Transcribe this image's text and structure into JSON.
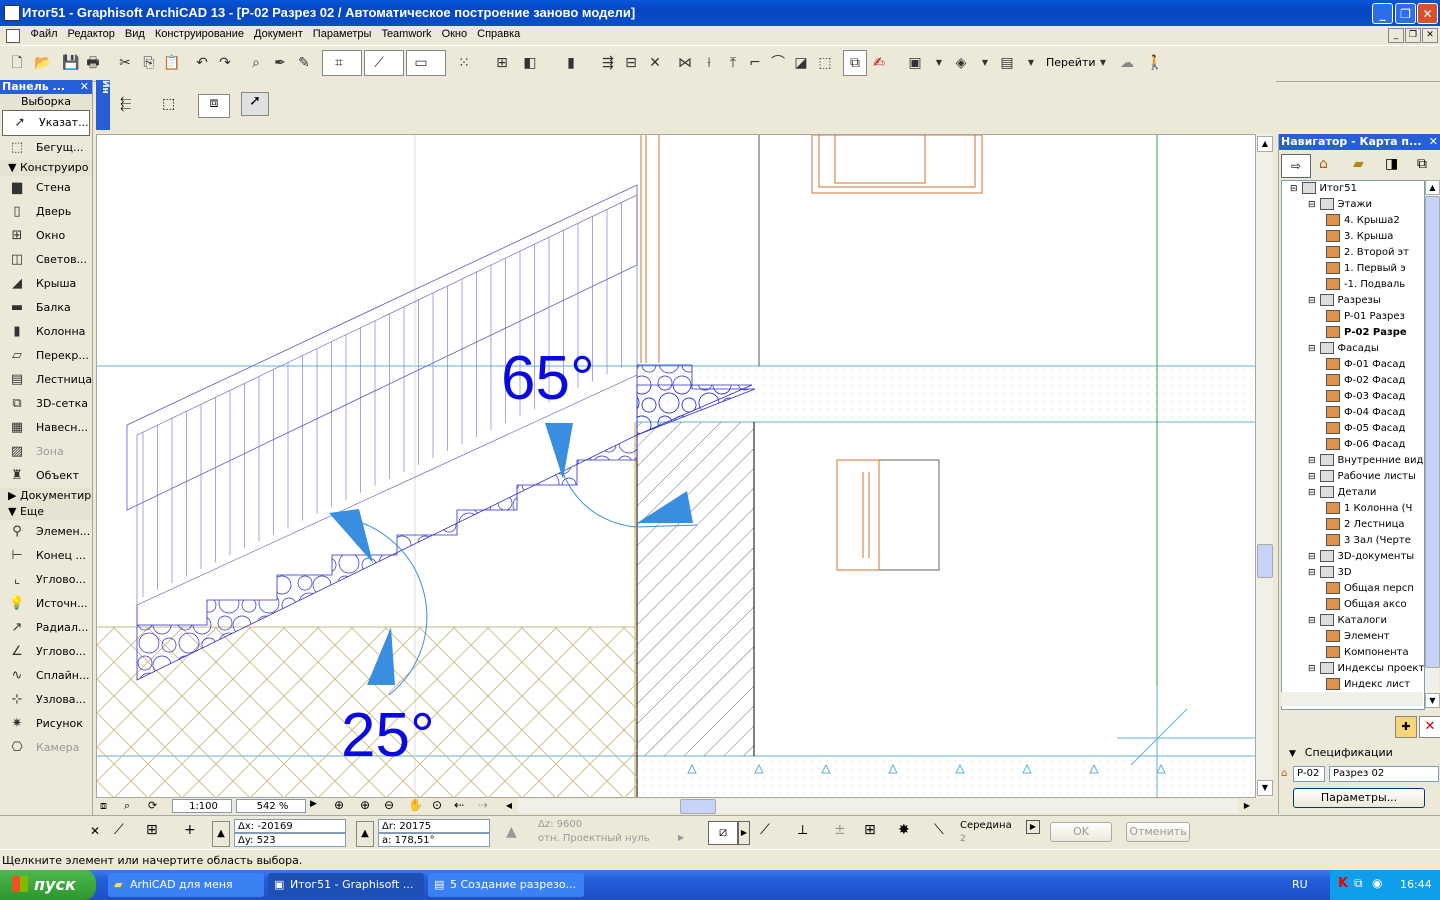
{
  "window": {
    "title": "Итог51 - Graphisoft ArchiCAD 13 - [Р-02 Разрез 02 / Автоматическое построение заново модели]"
  },
  "menu": [
    "Файл",
    "Редактор",
    "Вид",
    "Конструирование",
    "Документ",
    "Параметры",
    "Teamwork",
    "Окно",
    "Справка"
  ],
  "toolbar": {
    "goto_label": "Перейти"
  },
  "toolbox": {
    "title": "Панель ...",
    "select_section": "Выборка",
    "items_select": [
      {
        "label": "Указат...",
        "icon": "arrow-icon"
      },
      {
        "label": "Бегущ...",
        "icon": "marquee-icon"
      }
    ],
    "section_design": "Конструиро",
    "items_design": [
      {
        "label": "Стена",
        "icon": "wall-icon"
      },
      {
        "label": "Дверь",
        "icon": "door-icon"
      },
      {
        "label": "Окно",
        "icon": "window-icon"
      },
      {
        "label": "Светов...",
        "icon": "skylight-icon"
      },
      {
        "label": "Крыша",
        "icon": "roof-icon"
      },
      {
        "label": "Балка",
        "icon": "beam-icon"
      },
      {
        "label": "Колонна",
        "icon": "column-icon"
      },
      {
        "label": "Перекр...",
        "icon": "slab-icon"
      },
      {
        "label": "Лестница",
        "icon": "stair-icon"
      },
      {
        "label": "3D-сетка",
        "icon": "mesh-icon"
      },
      {
        "label": "Навесн...",
        "icon": "curtain-wall-icon"
      },
      {
        "label": "Зона",
        "icon": "zone-icon"
      },
      {
        "label": "Объект",
        "icon": "object-icon"
      }
    ],
    "section_document": "Документир",
    "section_more": "Еще",
    "items_more": [
      {
        "label": "Элемен...",
        "icon": "element-icon"
      },
      {
        "label": "Конец ...",
        "icon": "end-icon"
      },
      {
        "label": "Углово...",
        "icon": "corner-icon"
      },
      {
        "label": "Источн...",
        "icon": "lamp-icon"
      },
      {
        "label": "Радиал...",
        "icon": "radial-dim-icon"
      },
      {
        "label": "Углово...",
        "icon": "angle-dim-icon"
      },
      {
        "label": "Сплайн...",
        "icon": "spline-icon"
      },
      {
        "label": "Узлова...",
        "icon": "hotspot-icon"
      },
      {
        "label": "Рисунок",
        "icon": "figure-icon"
      },
      {
        "label": "Камера",
        "icon": "camera-icon"
      }
    ]
  },
  "info_box": {
    "tab": "Ин"
  },
  "canvas": {
    "angle_top": "65°",
    "angle_bottom": "25°"
  },
  "view": {
    "scale": "1:100",
    "zoom": "542 %"
  },
  "navigator": {
    "title": "Навигатор - Карта п...",
    "tree": [
      {
        "label": "Итог51",
        "level": 0,
        "bold": false
      },
      {
        "label": "Этажи",
        "level": 1
      },
      {
        "label": "4. Крыша2",
        "level": 2
      },
      {
        "label": "3. Крыша",
        "level": 2
      },
      {
        "label": "2. Второй эт",
        "level": 2
      },
      {
        "label": "1. Первый э",
        "level": 2
      },
      {
        "label": "-1. Подваль",
        "level": 2
      },
      {
        "label": "Разрезы",
        "level": 1
      },
      {
        "label": "Р-01 Разрез",
        "level": 2
      },
      {
        "label": "Р-02 Разре",
        "level": 2,
        "bold": true
      },
      {
        "label": "Фасады",
        "level": 1
      },
      {
        "label": "Ф-01 Фасад",
        "level": 2
      },
      {
        "label": "Ф-02 Фасад",
        "level": 2
      },
      {
        "label": "Ф-03 Фасад",
        "level": 2
      },
      {
        "label": "Ф-04 Фасад",
        "level": 2
      },
      {
        "label": "Ф-05 Фасад",
        "level": 2
      },
      {
        "label": "Ф-06 Фасад",
        "level": 2
      },
      {
        "label": "Внутренние вид",
        "level": 1
      },
      {
        "label": "Рабочие листы",
        "level": 1
      },
      {
        "label": "Детали",
        "level": 1
      },
      {
        "label": "1 Колонна (Ч",
        "level": 2
      },
      {
        "label": "2 Лестница",
        "level": 2
      },
      {
        "label": "3 Зал (Черте",
        "level": 2
      },
      {
        "label": "3D-документы",
        "level": 1
      },
      {
        "label": "3D",
        "level": 1
      },
      {
        "label": "Общая персп",
        "level": 2
      },
      {
        "label": "Общая аксо",
        "level": 2
      },
      {
        "label": "Каталоги",
        "level": 1
      },
      {
        "label": "Элемент",
        "level": 2
      },
      {
        "label": "Компонента",
        "level": 2
      },
      {
        "label": "Индексы проект",
        "level": 1
      },
      {
        "label": "Индекс лист",
        "level": 2
      }
    ],
    "specs_label": "Спецификации",
    "spec_id": "Р-02",
    "spec_name": "Разрез 02",
    "params_button": "Параметры..."
  },
  "coords": {
    "dx": "Δx: -20169",
    "dy": "Δy: 523",
    "dr": "Δr: 20175",
    "da": "a: 178,51°",
    "dz": "Δz: 9600",
    "ref": "отн. Проектный нуль",
    "snap": "Середина",
    "snap_n": "2",
    "ok": "OK",
    "cancel": "Отменить"
  },
  "status": "Щелкните элемент или начертите область выбора.",
  "taskbar": {
    "start": "пуск",
    "tasks": [
      "ArhiCAD для меня",
      "Итог51 - Graphisoft ...",
      "5 Создание разрезо..."
    ],
    "lang": "RU",
    "clock": "16:44"
  }
}
